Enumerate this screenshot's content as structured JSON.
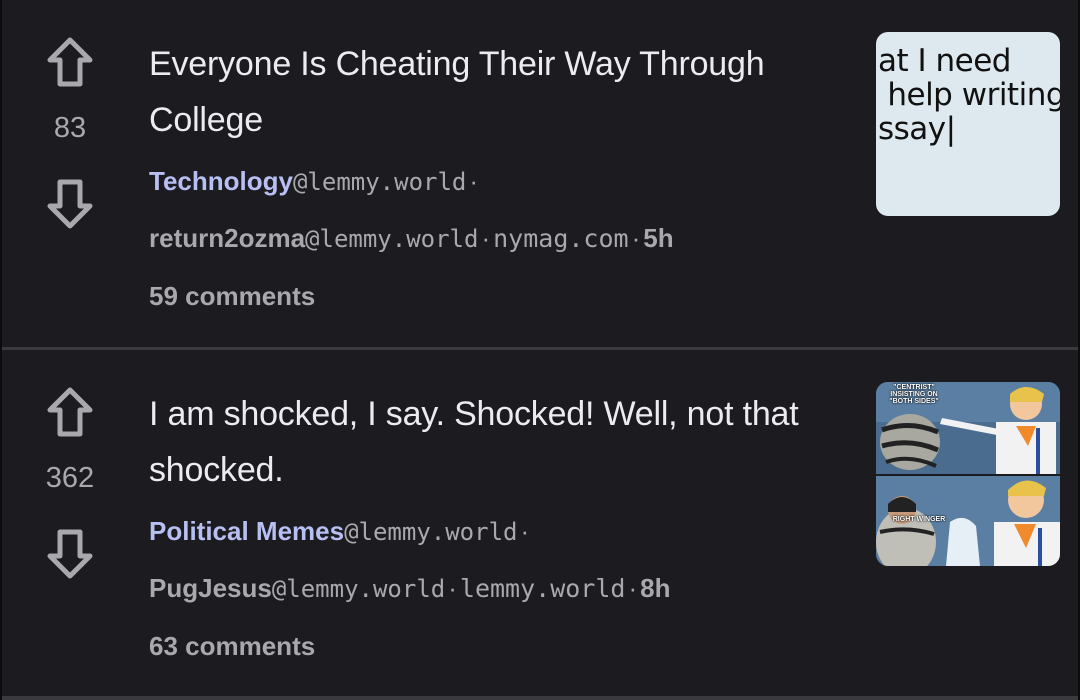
{
  "posts": [
    {
      "score": "83",
      "title": "Everyone Is Cheating Their Way Through College",
      "community": "Technology",
      "community_instance": "@lemmy.world",
      "author": "return2ozma",
      "author_instance": "@lemmy.world",
      "domain": "nymag.com",
      "age": "5h",
      "comments": "59 comments",
      "separator": "·",
      "thumbnail_text": "at I need\n help writing\nssay|"
    },
    {
      "score": "362",
      "title": "I am shocked, I say. Shocked! Well, not that shocked.",
      "community": "Political Memes",
      "community_instance": "@lemmy.world",
      "author": "PugJesus",
      "author_instance": "@lemmy.world",
      "domain": "lemmy.world",
      "age": "8h",
      "comments": "63 comments",
      "separator": "·",
      "thumbnail_labels": [
        "\"CENTRIST\"\nINSISTING ON\n\"BOTH SIDES\"",
        "RIGHT-WINGER"
      ]
    }
  ],
  "icons": {
    "upvote": "arrow-up-icon",
    "downvote": "arrow-down-icon"
  },
  "colors": {
    "background": "#1c1b20",
    "community": "#b7bff3",
    "text": "#ecebef",
    "muted": "#a9a8ad"
  }
}
